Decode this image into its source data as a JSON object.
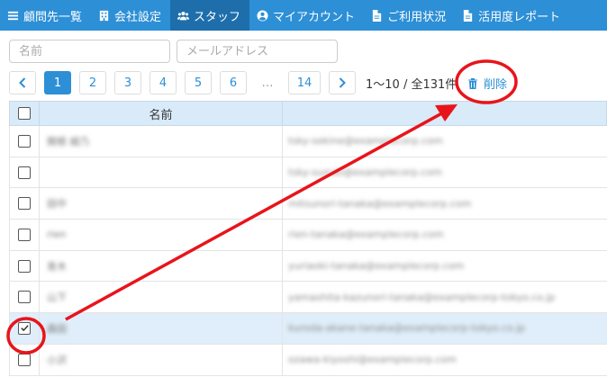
{
  "nav": {
    "items": [
      {
        "label": "顧問先一覧",
        "icon": "list-icon",
        "active": false
      },
      {
        "label": "会社設定",
        "icon": "building-icon",
        "active": false
      },
      {
        "label": "スタッフ",
        "icon": "users-icon",
        "active": true
      },
      {
        "label": "マイアカウント",
        "icon": "user-circle-icon",
        "active": false
      },
      {
        "label": "ご利用状況",
        "icon": "file-icon",
        "active": false
      },
      {
        "label": "活用度レポート",
        "icon": "file-icon",
        "active": false
      }
    ]
  },
  "search": {
    "name_placeholder": "名前",
    "email_placeholder": "メールアドレス"
  },
  "pagination": {
    "prev": "‹",
    "next": "›",
    "pages": [
      "1",
      "2",
      "3",
      "4",
      "5",
      "6"
    ],
    "ellipsis": "…",
    "last": "14",
    "current": "1",
    "info": "1〜10 / 全131件",
    "delete_label": "削除"
  },
  "table": {
    "columns": [
      "名前",
      ""
    ],
    "rows": [
      {
        "name": "関根 綾乃",
        "email": "tsky-sekine@examplecorp.com",
        "checked": false
      },
      {
        "name": "",
        "email": "tsky-suzuki@examplecorp.com",
        "checked": false
      },
      {
        "name": "田中",
        "email": "mitsunori-tanaka@examplecorp.com",
        "checked": false
      },
      {
        "name": "rien",
        "email": "rien-tanaka@examplecorp.com",
        "checked": false
      },
      {
        "name": "青木",
        "email": "yuriaoki-tanaka@examplecorp.com",
        "checked": false
      },
      {
        "name": "山下",
        "email": "yamashita-kazunori-tanaka@examplecorp-tokyo.co.jp",
        "checked": false
      },
      {
        "name": "森田",
        "email": "kuroda-akane-tanaka@examplecorp-tokyo.co.jp",
        "checked": true
      },
      {
        "name": "小沢",
        "email": "ozawa-kiyoshi@examplecorp.com",
        "checked": false
      }
    ]
  },
  "colors": {
    "nav_bg": "#2d8fd6",
    "nav_active": "#1d6eab",
    "accent": "#2d8fd6",
    "annotation": "#e8141b"
  }
}
